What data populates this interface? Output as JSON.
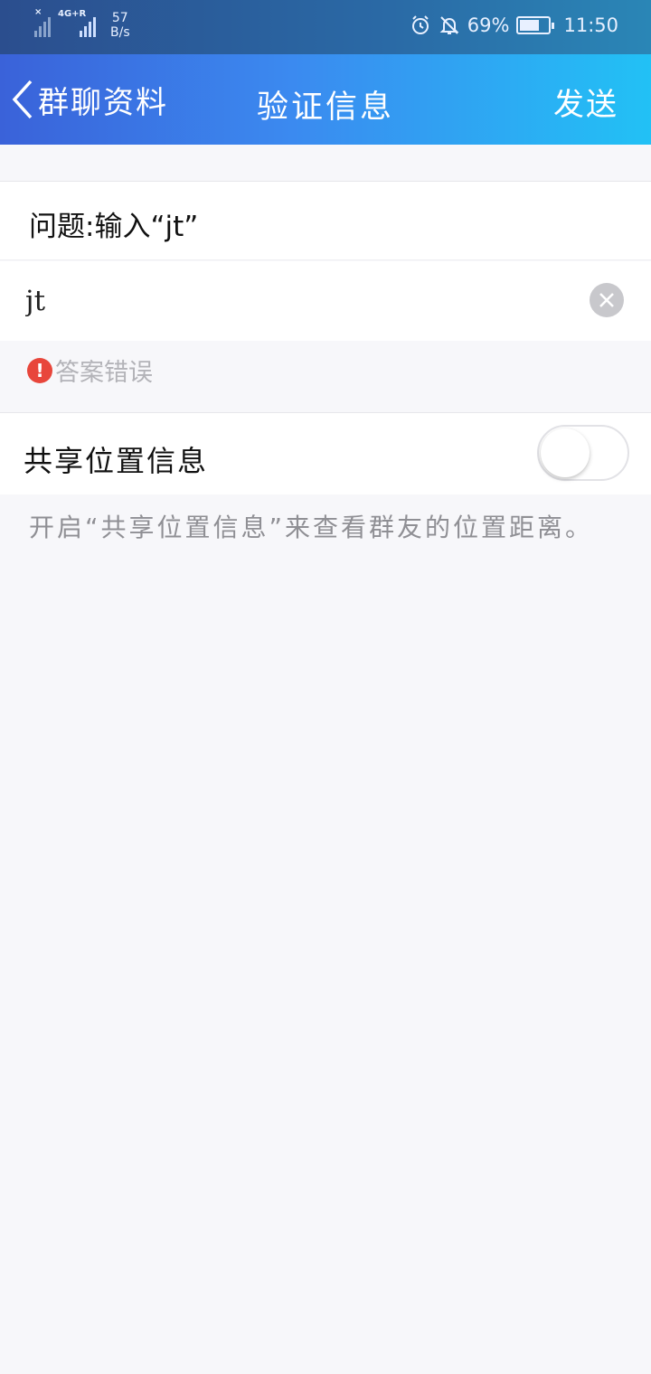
{
  "status_bar": {
    "net_speed_value": "57",
    "net_speed_unit": "B/s",
    "network_type": "4G+R",
    "battery_percent": "69%",
    "battery_level": 0.69,
    "time": "11:50"
  },
  "navbar": {
    "back_label": "群聊资料",
    "title": "验证信息",
    "send_label": "发送"
  },
  "form": {
    "question": "问题:输入“jt”",
    "answer_value": "jt",
    "error_text": "答案错误"
  },
  "share_location": {
    "label": "共享位置信息",
    "enabled": false,
    "hint": "开启“共享位置信息”来查看群友的位置距离。"
  },
  "colors": {
    "header_start": "#3a62d9",
    "header_end": "#22c1f5",
    "error": "#e8463b",
    "background": "#f7f7fa"
  }
}
